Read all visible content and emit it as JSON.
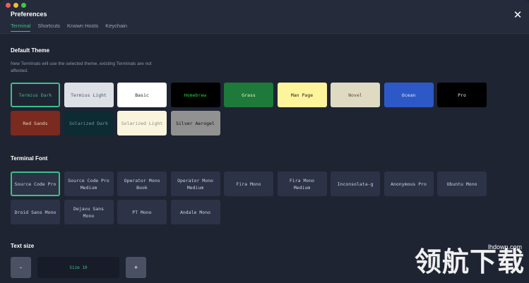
{
  "window": {
    "title": "Preferences",
    "close_glyph": "✕"
  },
  "tabs": [
    {
      "label": "Terminal",
      "active": true
    },
    {
      "label": "Shortcuts",
      "active": false
    },
    {
      "label": "Known Hosts",
      "active": false
    },
    {
      "label": "Keychain",
      "active": false
    }
  ],
  "theme_section": {
    "title": "Default Theme",
    "description": "New Terminals will use the selected theme, existing Terminals are not affected.",
    "themes": [
      {
        "label": "Termius Dark",
        "bg": "#1f2433",
        "fg": "#3cbf8a",
        "selected": true
      },
      {
        "label": "Termius Light",
        "bg": "#dde1e6",
        "fg": "#4a5163",
        "selected": false
      },
      {
        "label": "Basic",
        "bg": "#ffffff",
        "fg": "#222222",
        "selected": false
      },
      {
        "label": "Homebrew",
        "bg": "#000000",
        "fg": "#2bd63a",
        "selected": false
      },
      {
        "label": "Grass",
        "bg": "#1d7a3a",
        "fg": "#f4f0c8",
        "selected": false
      },
      {
        "label": "Man Page",
        "bg": "#fef49c",
        "fg": "#222222",
        "selected": false
      },
      {
        "label": "Novel",
        "bg": "#dfdbc3",
        "fg": "#5a4a30",
        "selected": false
      },
      {
        "label": "Ocean",
        "bg": "#2c59c6",
        "fg": "#e6ecff",
        "selected": false
      },
      {
        "label": "Pro",
        "bg": "#000000",
        "fg": "#e6e6e6",
        "selected": false
      },
      {
        "label": "Red Sands",
        "bg": "#7a2a1e",
        "fg": "#e9d7b8",
        "selected": false
      },
      {
        "label": "Solarized Dark",
        "bg": "#0d2b33",
        "fg": "#7f9494",
        "selected": false
      },
      {
        "label": "Solarized Light",
        "bg": "#fbf4dd",
        "fg": "#7f8e8e",
        "selected": false
      },
      {
        "label": "Silver Aerogel",
        "bg": "#919191",
        "fg": "#111111",
        "selected": false
      }
    ]
  },
  "font_section": {
    "title": "Terminal Font",
    "fonts": [
      {
        "label": "Source Code Pro",
        "selected": true
      },
      {
        "label": "Source Code Pro Medium",
        "selected": false
      },
      {
        "label": "Operator Mono Book",
        "selected": false
      },
      {
        "label": "Operator Mono Medium",
        "selected": false
      },
      {
        "label": "Fira Mono",
        "selected": false
      },
      {
        "label": "Fira Mono Medium",
        "selected": false
      },
      {
        "label": "Inconsolata-g",
        "selected": false
      },
      {
        "label": "Anonymous Pro",
        "selected": false
      },
      {
        "label": "Ubuntu Mono",
        "selected": false
      },
      {
        "label": "Droid Sans Mono",
        "selected": false
      },
      {
        "label": "Dejavu Sans Mono",
        "selected": false
      },
      {
        "label": "PT Mono",
        "selected": false
      },
      {
        "label": "Andale Mono",
        "selected": false
      }
    ]
  },
  "text_size_section": {
    "title": "Text size",
    "decrease_label": "-",
    "value_label": "Size 10",
    "increase_label": "+"
  },
  "watermark": {
    "chars": "领航下载",
    "url": "lhdown.com"
  },
  "colors": {
    "accent": "#3cbf8a",
    "background": "#1f2433"
  }
}
